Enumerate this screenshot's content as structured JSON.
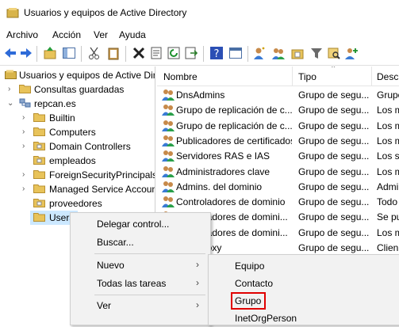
{
  "window": {
    "title": "Usuarios y equipos de Active Directory"
  },
  "menubar": {
    "items": [
      "Archivo",
      "Acción",
      "Ver",
      "Ayuda"
    ]
  },
  "toolbar": {
    "icons": [
      "back-arrow-icon",
      "forward-arrow-icon",
      "up-folder-icon",
      "show-pane-icon",
      "cut-icon",
      "paste-icon",
      "delete-icon",
      "properties-icon",
      "refresh-icon",
      "export-icon",
      "help-icon",
      "console-icon",
      "new-user-icon",
      "new-group-icon",
      "new-ou-icon",
      "filter-icon",
      "find-icon",
      "add-to-group-icon"
    ]
  },
  "tree": {
    "root": "Usuarios y equipos de Active Directory",
    "saved_queries": "Consultas guardadas",
    "domain": "repcan.es",
    "children": [
      "Builtin",
      "Computers",
      "Domain Controllers",
      "empleados",
      "ForeignSecurityPrincipals",
      "Managed Service Accounts",
      "proveedores",
      "Users"
    ]
  },
  "list": {
    "columns": [
      "Nombre",
      "Tipo",
      "Descr"
    ],
    "rows": [
      {
        "name": "DnsAdmins",
        "type": "Grupo de segu...",
        "desc": "Grupo"
      },
      {
        "name": "Grupo de replicación de c...",
        "type": "Grupo de segu...",
        "desc": "Los m"
      },
      {
        "name": "Grupo de replicación de c...",
        "type": "Grupo de segu...",
        "desc": "Los m"
      },
      {
        "name": "Publicadores de certificados",
        "type": "Grupo de segu...",
        "desc": "Los m"
      },
      {
        "name": "Servidores RAS e IAS",
        "type": "Grupo de segu...",
        "desc": "Los s"
      },
      {
        "name": "Administradores clave",
        "type": "Grupo de segu...",
        "desc": "Los m"
      },
      {
        "name": "Admins. del dominio",
        "type": "Grupo de segu...",
        "desc": "Admi"
      },
      {
        "name": "Controladores de dominio",
        "type": "Grupo de segu...",
        "desc": "Todo"
      },
      {
        "name": "Controladores de domini...",
        "type": "Grupo de segu...",
        "desc": "Se pu"
      },
      {
        "name": "Controladores de domini...",
        "type": "Grupo de segu...",
        "desc": "Los m"
      },
      {
        "name": "...ateProxy",
        "type": "Grupo de segu...",
        "desc": "Clien"
      }
    ]
  },
  "context_menu": {
    "items": [
      "Delegar control...",
      "Buscar...",
      "Nuevo",
      "Todas las tareas",
      "Ver"
    ]
  },
  "submenu_nuevo": {
    "items": [
      "Equipo",
      "Contacto",
      "Grupo",
      "InetOrgPerson"
    ]
  },
  "colors": {
    "highlight_box": "#e00000",
    "folder": "#e8c35a",
    "menu_bg": "#f2f2f2",
    "tree_selected": "#cce8ff"
  }
}
